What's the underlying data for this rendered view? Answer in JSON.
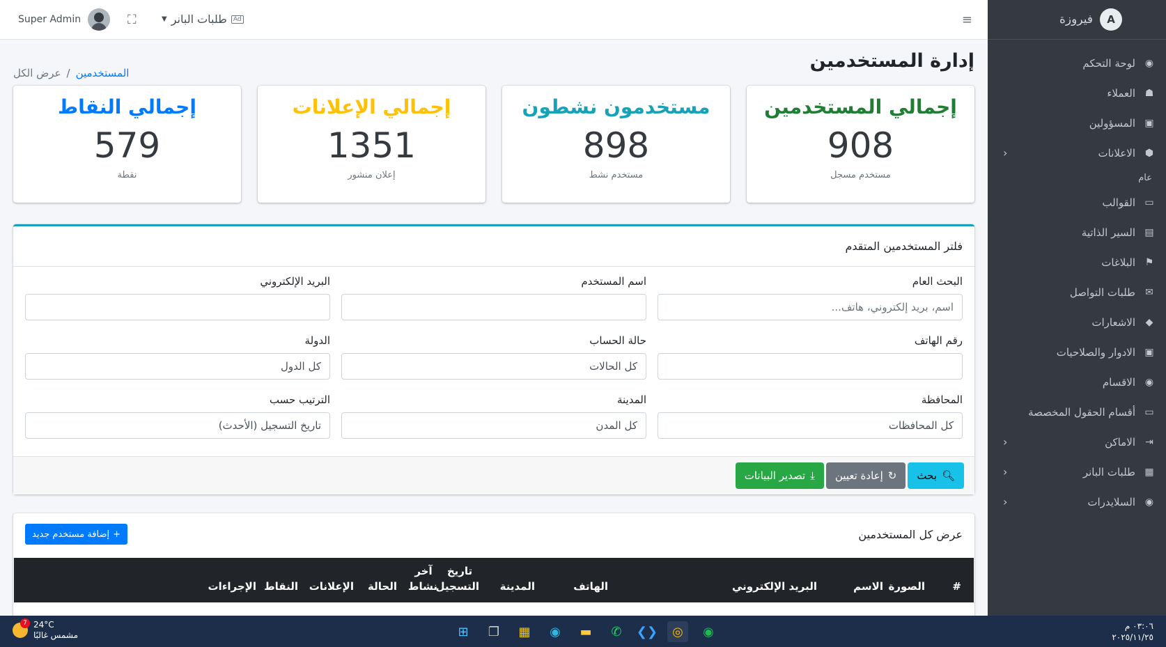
{
  "sidebar": {
    "brand": "فيروزة",
    "brand_logo": "A",
    "items": [
      {
        "label": "لوحة التحكم",
        "icon": "palette-icon",
        "glyph": "◉"
      },
      {
        "label": "العملاء",
        "icon": "users-icon",
        "glyph": "☗"
      },
      {
        "label": "المسؤولين",
        "icon": "id-card-icon",
        "glyph": "▣"
      },
      {
        "label": "الاعلانات",
        "icon": "cube-icon",
        "glyph": "⬢",
        "arrow": "‹"
      }
    ],
    "section_header": "عام",
    "items2": [
      {
        "label": "القوالب",
        "icon": "folder-icon",
        "glyph": "▭"
      },
      {
        "label": "السير الذاتية",
        "icon": "portrait-icon",
        "glyph": "▤"
      },
      {
        "label": "البلاغات",
        "icon": "flag-icon",
        "glyph": "⚑"
      },
      {
        "label": "طلبات التواصل",
        "icon": "envelope-icon",
        "glyph": "✉"
      },
      {
        "label": "الاشعارات",
        "icon": "bell-icon",
        "glyph": "◆"
      },
      {
        "label": "الادوار والصلاحيات",
        "icon": "id-card-icon",
        "glyph": "▣"
      },
      {
        "label": "الاقسام",
        "icon": "palette-icon",
        "glyph": "◉"
      },
      {
        "label": "أقسام الحقول المخصصة",
        "icon": "folder-plus-icon",
        "glyph": "▭"
      },
      {
        "label": "الاماكن",
        "icon": "sign-in-icon",
        "glyph": "⇥",
        "arrow": "‹"
      },
      {
        "label": "طلبات البانر",
        "icon": "ad-icon",
        "glyph": "▦",
        "arrow": "‹"
      },
      {
        "label": "السلايدرات",
        "icon": "palette-icon",
        "glyph": "◉",
        "arrow": "‹"
      }
    ]
  },
  "topbar": {
    "user_name": "Super Admin",
    "banner_dropdown": "طلبات البانر",
    "ad_badge": "Ad"
  },
  "page": {
    "title": "إدارة المستخدمين",
    "breadcrumb_link": "المستخدمين",
    "breadcrumb_sep": "/",
    "breadcrumb_current": "عرض الكل"
  },
  "stats": [
    {
      "title": "إجمالي المستخدمين",
      "value": "908",
      "sub": "مستخدم مسجل",
      "color": "#1e7e34"
    },
    {
      "title": "مستخدمون نشطون",
      "value": "898",
      "sub": "مستخدم نشط",
      "color": "#17a2b8"
    },
    {
      "title": "إجمالي الإعلانات",
      "value": "1351",
      "sub": "إعلان منشور",
      "color": "#ffc107"
    },
    {
      "title": "إجمالي النقاط",
      "value": "579",
      "sub": "نقطة",
      "color": "#007bff"
    }
  ],
  "filter": {
    "title": "فلتر المستخدمين المتقدم",
    "fields": [
      {
        "label": "البحث العام",
        "value": "",
        "placeholder": "اسم، بريد إلكتروني، هاتف..."
      },
      {
        "label": "اسم المستخدم",
        "value": "",
        "placeholder": ""
      },
      {
        "label": "البريد الإلكتروني",
        "value": "",
        "placeholder": ""
      },
      {
        "label": "رقم الهاتف",
        "value": "",
        "placeholder": ""
      },
      {
        "label": "حالة الحساب",
        "value": "كل الحالات",
        "placeholder": ""
      },
      {
        "label": "الدولة",
        "value": "كل الدول",
        "placeholder": ""
      },
      {
        "label": "المحافظة",
        "value": "كل المحافظات",
        "placeholder": ""
      },
      {
        "label": "المدينة",
        "value": "كل المدن",
        "placeholder": ""
      },
      {
        "label": "الترتيب حسب",
        "value": "تاريخ التسجيل (الأحدث)",
        "placeholder": ""
      }
    ],
    "btn_search": "بحث",
    "btn_reset": "إعادة تعيين",
    "btn_export": "تصدير البيانات"
  },
  "users": {
    "title": "عرض كل المستخدمين",
    "add_button": "إضافة مستخدم جديد",
    "columns": [
      "#",
      "الصورة",
      "الاسم",
      "البريد الإلكتروني",
      "الهاتف",
      "المدينة",
      "تاريخ التسجيل",
      "آخر نشاط",
      "الحالة",
      "الإعلانات",
      "النقاط",
      "الإجراءات"
    ]
  },
  "taskbar": {
    "temp": "24°C",
    "weather": "مشمس غالبًا",
    "weather_badge": "7",
    "time": "٠٣:٠٦ م",
    "date": "٢٠٢٥/١١/٢٥"
  }
}
